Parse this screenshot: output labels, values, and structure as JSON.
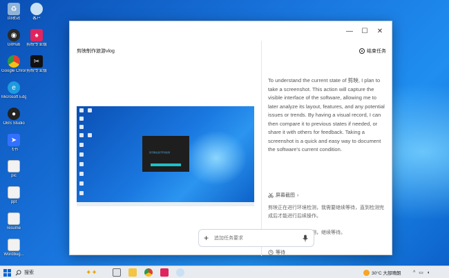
{
  "desktop": {
    "icons": [
      {
        "label": "回收站",
        "color": "#8fb3d9"
      },
      {
        "label": "客户",
        "color": "#c9e0f5"
      },
      {
        "label": "GitHub",
        "color": "#2a2a2a"
      },
      {
        "label": "剪映专业版",
        "color": "#e0245e"
      },
      {
        "label": "Google Chrome",
        "color": "#e04030"
      },
      {
        "label": "剪映专业版",
        "color": "#111111"
      },
      {
        "label": "Microsoft Edge",
        "color": "#1e9be0"
      },
      {
        "label": "OBS Studio",
        "color": "#222222"
      },
      {
        "label": "飞书",
        "color": "#3370ff"
      },
      {
        "label": "pic",
        "color": "#f2f2f2"
      },
      {
        "label": "ppt",
        "color": "#f2f2f2"
      },
      {
        "label": "resume",
        "color": "#f2f2f2"
      },
      {
        "label": "Wordbug...",
        "color": "#f2f2f2"
      }
    ]
  },
  "window": {
    "task_title": "剪映制作旅游vlog",
    "end_task_label": "结束任务",
    "controls": {
      "minimize": "—",
      "maximize": "☐",
      "close": "✕"
    },
    "thumbnail": {
      "dialog_message": "您可能在运行环境检测",
      "note": "screenshot thumbnail"
    },
    "assistant": {
      "english_message": "To understand the current state of 剪映, I plan to take a screenshot. This action will capture the visible interface of the software, allowing me to later analyze its layout, features, and any potential issues or trends. By having a visual record, I can then compare it to previous states if needed, or share it with others for feedback. Taking a screenshot is a quick and easy way to document the software's current condition.",
      "screenshot_link": "屏幕截图",
      "chinese_message_1": "剪映正在进行环境检测，我需要继续等待，直到检测完成后才能进行后续操作。",
      "chinese_message_2": "剪映正在进行环境检测，继续等待。",
      "waiting_label": "等待"
    },
    "input": {
      "placeholder": "追加任务要求"
    }
  },
  "taskbar": {
    "search_label": "搜索",
    "weather": "30°C 大部晴朗",
    "tray_arrow": "^"
  }
}
